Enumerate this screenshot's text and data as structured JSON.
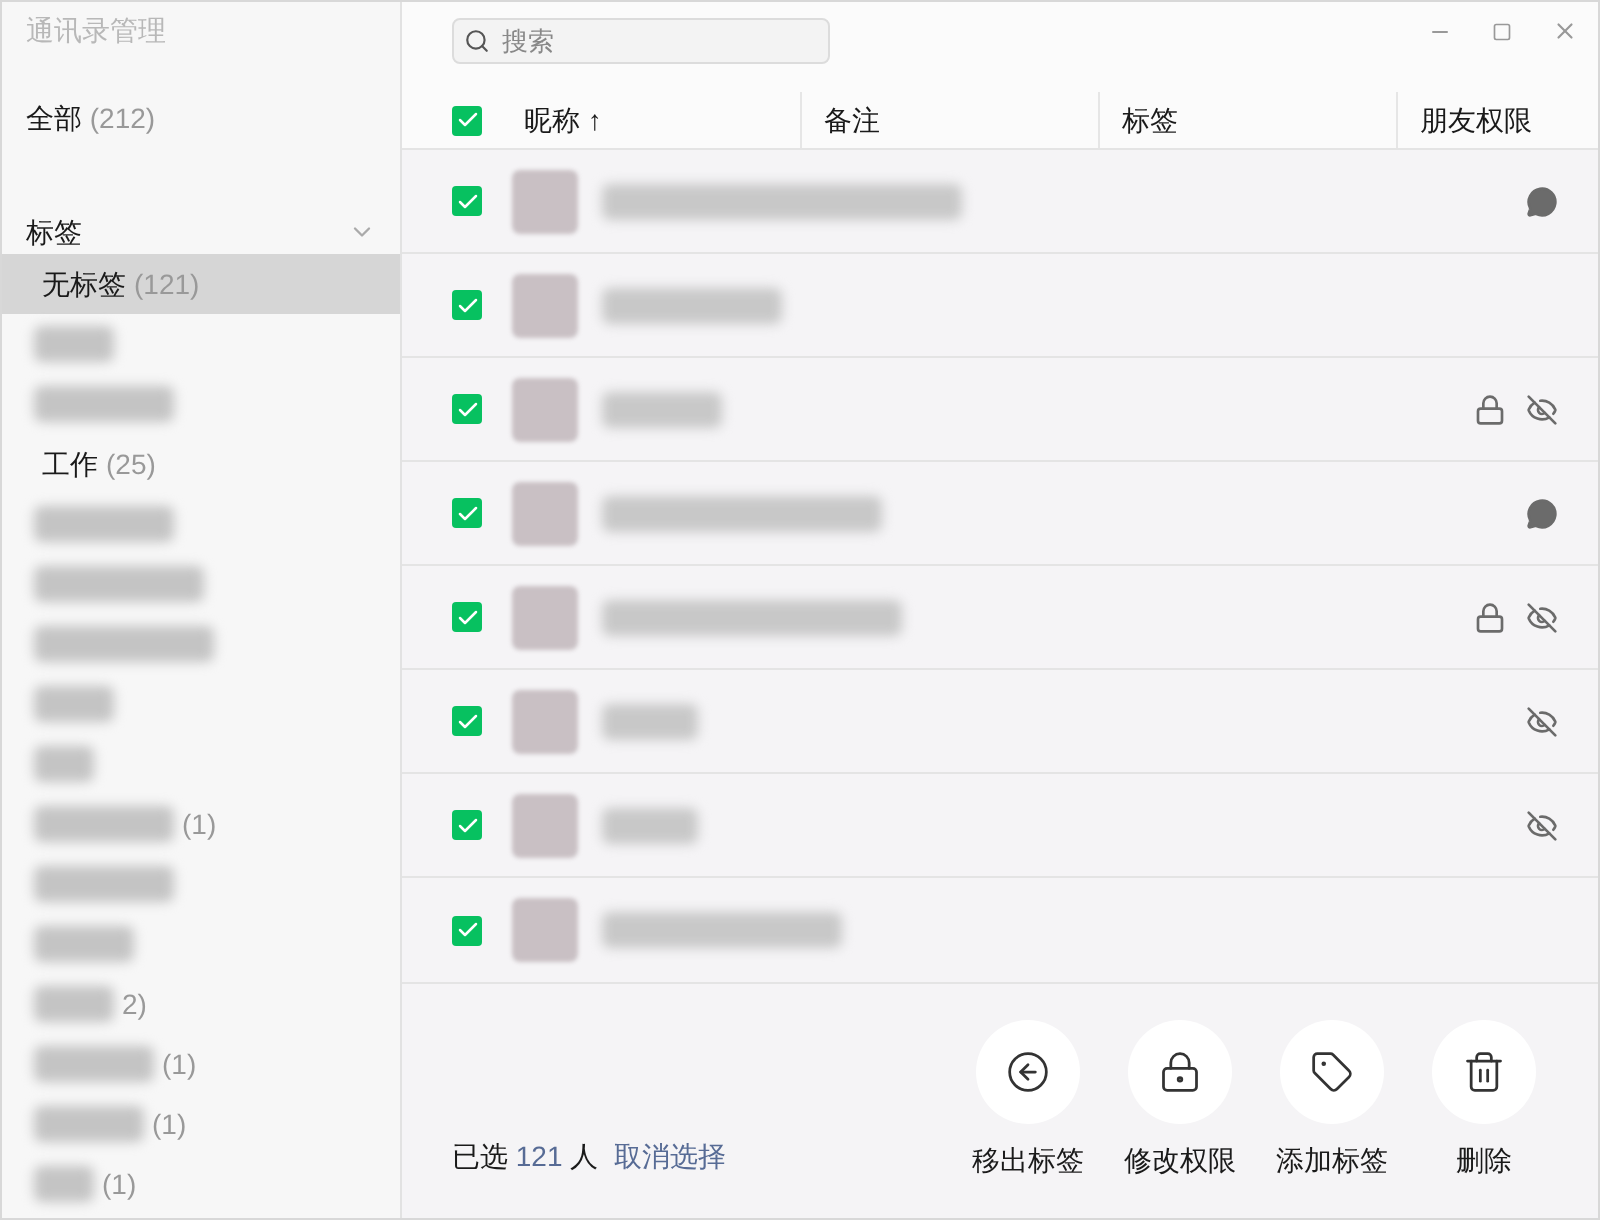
{
  "sidebar": {
    "title": "通讯录管理",
    "all": {
      "label": "全部",
      "count": "(212)"
    },
    "section": {
      "label": "标签",
      "expanded": true
    },
    "items": [
      {
        "kind": "label",
        "label": "无标签",
        "count": "(121)",
        "selected": true
      },
      {
        "kind": "redacted",
        "selected": false
      },
      {
        "kind": "redacted",
        "selected": false
      },
      {
        "kind": "label",
        "label": "工作",
        "count": "(25)",
        "selected": false
      },
      {
        "kind": "redacted",
        "selected": false
      },
      {
        "kind": "redacted",
        "selected": false
      },
      {
        "kind": "redacted",
        "selected": false
      },
      {
        "kind": "redacted",
        "selected": false
      },
      {
        "kind": "redacted",
        "selected": false
      },
      {
        "kind": "redacted",
        "count": "(1)",
        "selected": false
      },
      {
        "kind": "redacted",
        "selected": false
      },
      {
        "kind": "redacted",
        "selected": false
      },
      {
        "kind": "redacted",
        "count": "2)",
        "selected": false
      },
      {
        "kind": "redacted",
        "count": "(1)",
        "selected": false
      },
      {
        "kind": "redacted",
        "count": "(1)",
        "selected": false
      },
      {
        "kind": "redacted",
        "count": "(1)",
        "selected": false
      }
    ]
  },
  "search": {
    "placeholder": "搜索"
  },
  "table": {
    "all_checked": true,
    "columns": [
      "昵称 ↑",
      "备注",
      "标签",
      "朋友权限"
    ],
    "rows": [
      {
        "checked": true,
        "chat_only": true,
        "hide_my_moments": false,
        "hide_their_moments": false
      },
      {
        "checked": true,
        "chat_only": false,
        "hide_my_moments": false,
        "hide_their_moments": false
      },
      {
        "checked": true,
        "chat_only": false,
        "hide_my_moments": true,
        "hide_their_moments": true
      },
      {
        "checked": true,
        "chat_only": true,
        "hide_my_moments": false,
        "hide_their_moments": false
      },
      {
        "checked": true,
        "chat_only": false,
        "hide_my_moments": true,
        "hide_their_moments": true
      },
      {
        "checked": true,
        "chat_only": false,
        "hide_my_moments": false,
        "hide_their_moments": true
      },
      {
        "checked": true,
        "chat_only": false,
        "hide_my_moments": false,
        "hide_their_moments": true
      },
      {
        "checked": true,
        "chat_only": false,
        "hide_my_moments": false,
        "hide_their_moments": false
      }
    ]
  },
  "footer": {
    "selected_prefix": "已选",
    "selected_count": "121",
    "selected_suffix": "人",
    "clear": "取消选择",
    "actions": [
      {
        "kind": "remove",
        "label": "移出标签"
      },
      {
        "kind": "lock",
        "label": "修改权限"
      },
      {
        "kind": "tag",
        "label": "添加标签"
      },
      {
        "kind": "delete",
        "label": "删除"
      }
    ]
  }
}
